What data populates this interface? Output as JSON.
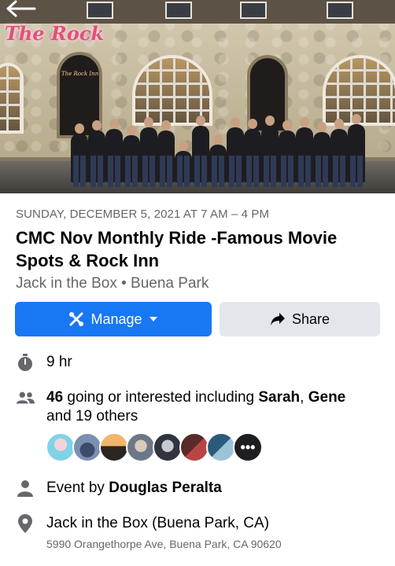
{
  "cover": {
    "sign_text": "The Rock",
    "door_label": "The Rock Inn"
  },
  "event": {
    "datetime": "SUNDAY, DECEMBER 5, 2021 AT 7 AM – 4 PM",
    "title": "CMC Nov Monthly Ride -Famous Movie Spots & Rock Inn",
    "location_short": "Jack in the Box • Buena Park"
  },
  "actions": {
    "manage_label": "Manage",
    "share_label": "Share"
  },
  "details": {
    "duration": "9 hr",
    "going_count": "46",
    "going_text": " going or interested including ",
    "friend_1": "Sarah",
    "separator": ", ",
    "friend_2": "Gene",
    "others_text": "and 19 others",
    "more_avatar_label": "•••",
    "host_prefix": "Event by ",
    "host_name": "Douglas Peralta",
    "venue_name": "Jack in the Box (Buena Park, CA)",
    "venue_address": "5990 Orangethorpe Ave, Buena Park, CA 90620"
  },
  "icons": {
    "back": "back-arrow-icon",
    "manage": "wrench-icon",
    "manage_dropdown": "caret-down-icon",
    "share": "share-arrow-icon",
    "duration": "stopwatch-icon",
    "guests": "people-icon",
    "host": "person-icon",
    "location": "location-pin-icon"
  },
  "colors": {
    "primary": "#1877f2",
    "secondary_button": "#e4e6eb",
    "muted_text": "#65676b",
    "icon_gray": "#65676b"
  }
}
